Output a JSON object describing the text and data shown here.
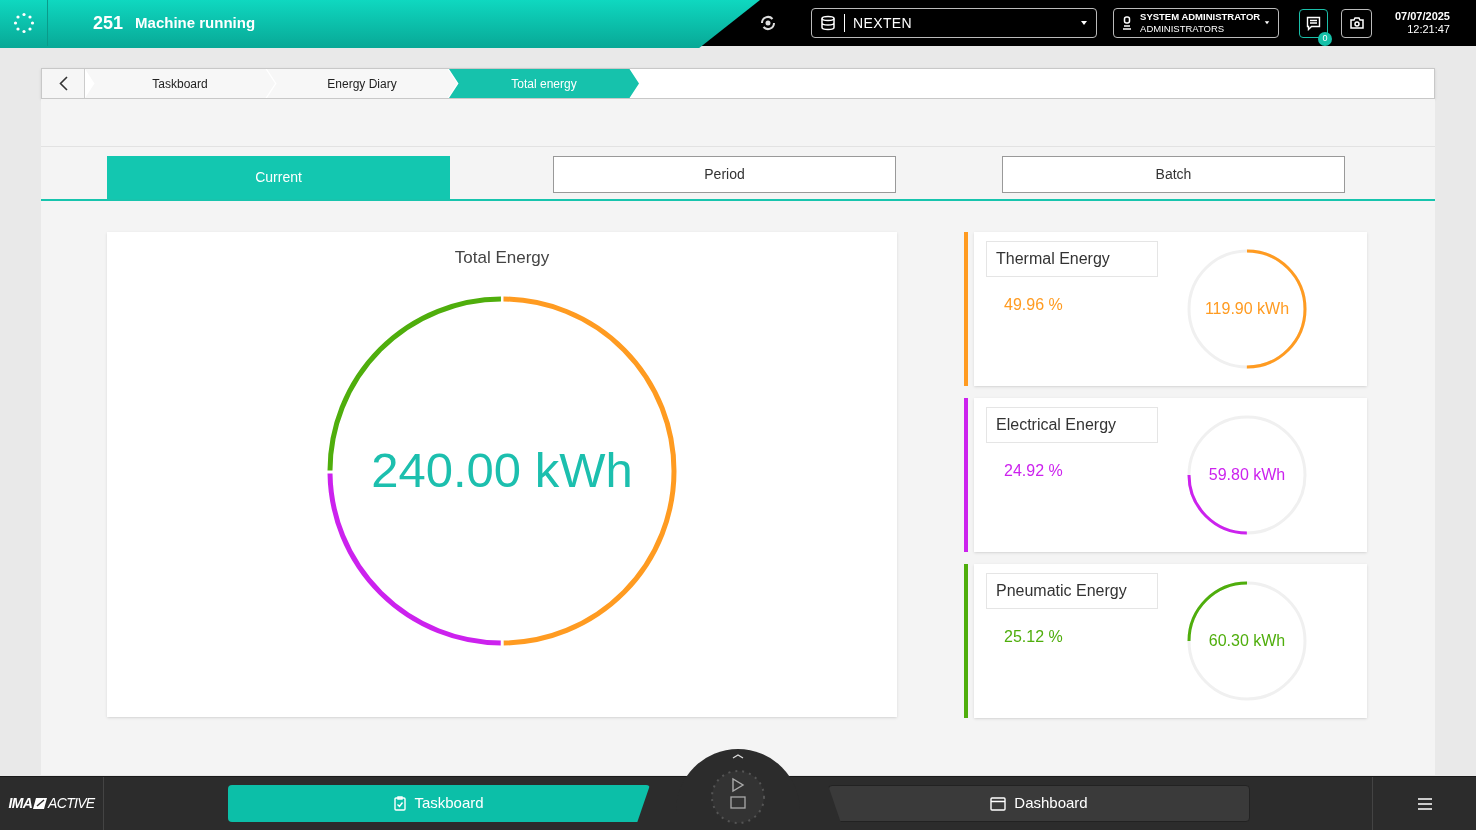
{
  "status": {
    "code": "251",
    "text": "Machine running"
  },
  "database": {
    "value": "NEXTEN"
  },
  "user": {
    "name": "SYSTEM ADMINISTRATOR",
    "role": "ADMINISTRATORS"
  },
  "notifications": {
    "count": "0"
  },
  "datetime": {
    "date": "07/07/2025",
    "time": "12:21:47"
  },
  "breadcrumb": [
    {
      "label": "Taskboard",
      "selected": false
    },
    {
      "label": "Energy Diary",
      "selected": false
    },
    {
      "label": "Total energy",
      "selected": true
    }
  ],
  "tabs": [
    {
      "label": "Current",
      "selected": true
    },
    {
      "label": "Period",
      "selected": false
    },
    {
      "label": "Batch",
      "selected": false
    }
  ],
  "total": {
    "title": "Total Energy",
    "value": "240.00",
    "unit": "kWh"
  },
  "energies": [
    {
      "name": "Thermal Energy",
      "percent": "49.96 %",
      "value": "119.90 kWh",
      "level": 0.4996,
      "color": "#ff9b21"
    },
    {
      "name": "Electrical Energy",
      "percent": "24.92 %",
      "value": "59.80 kWh",
      "level": 0.2492,
      "color": "#cc22ee"
    },
    {
      "name": "Pneumatic Energy",
      "percent": "25.12 %",
      "value": "60.30 kWh",
      "level": 0.2512,
      "color": "#4fae0c"
    }
  ],
  "brand": {
    "left": "IMA",
    "right": "ACTIVE"
  },
  "bottom_nav": [
    {
      "label": "Taskboard",
      "selected": true,
      "kind": "clipboard"
    },
    {
      "label": "Dashboard",
      "selected": false,
      "kind": "window"
    }
  ]
}
